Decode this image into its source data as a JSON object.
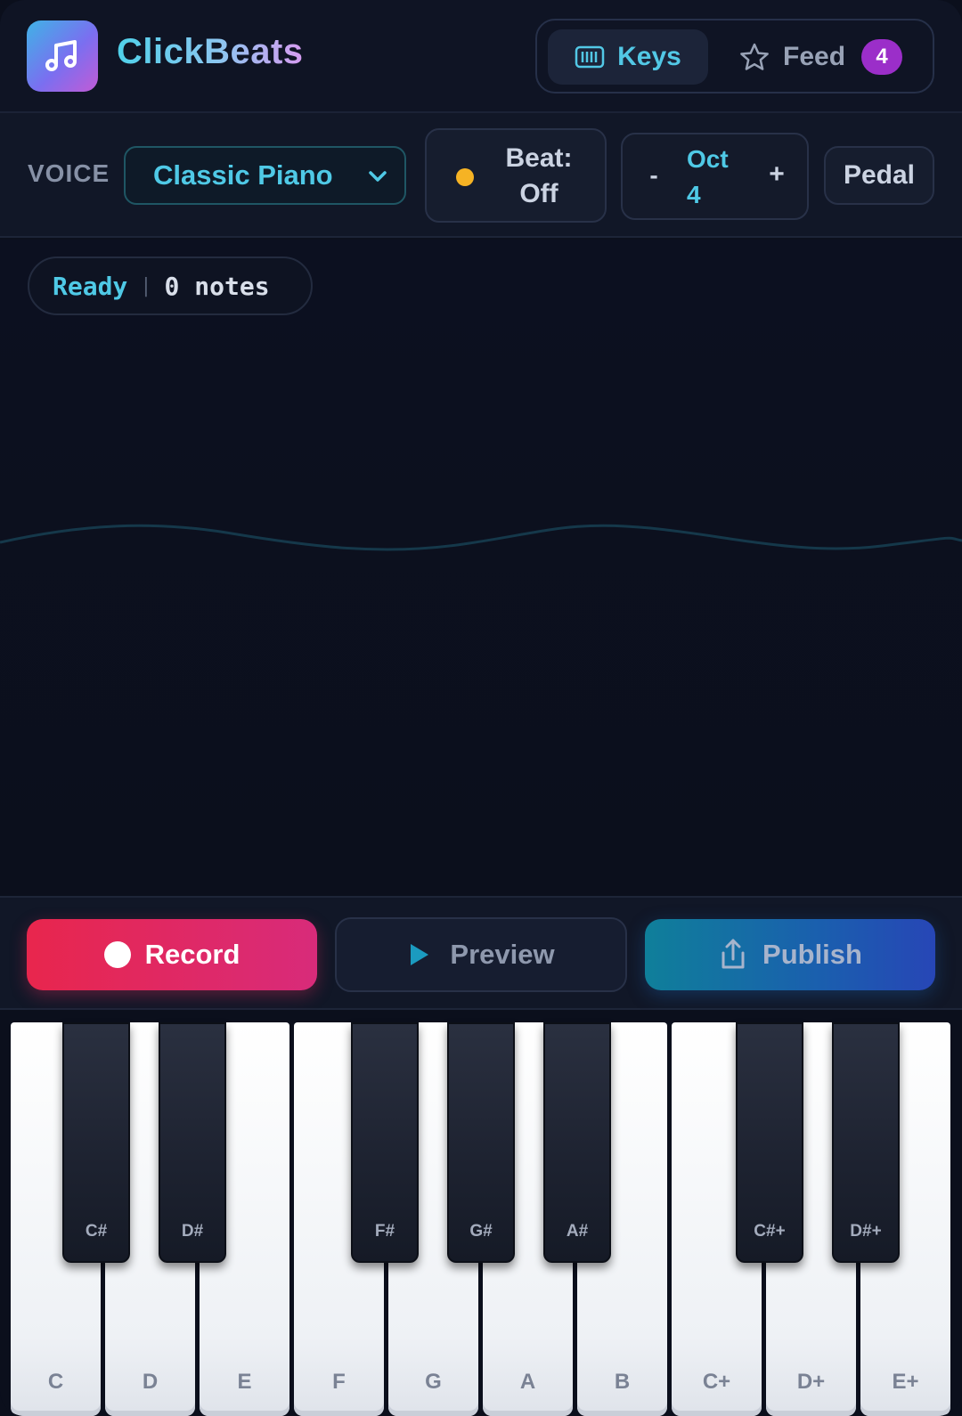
{
  "app": {
    "title": "ClickBeats"
  },
  "nav": {
    "keys_label": "Keys",
    "feed_label": "Feed",
    "feed_count": "4"
  },
  "controls": {
    "voice_label": "VOICE",
    "voice_value": "Classic Piano",
    "beat_line1": "Beat:",
    "beat_line2": "Off",
    "oct_minus": "-",
    "oct_line1": "Oct",
    "oct_line2": "4",
    "oct_plus": "+",
    "pedal_label": "Pedal"
  },
  "status": {
    "state": "Ready",
    "separator": "|",
    "count": "0 notes"
  },
  "actions": {
    "record_label": "Record",
    "preview_label": "Preview",
    "publish_label": "Publish"
  },
  "keyboard": {
    "white_keys": [
      "C",
      "D",
      "E",
      "F",
      "G",
      "A",
      "B",
      "C+",
      "D+",
      "E+"
    ],
    "black_keys": [
      "C#",
      "D#",
      "F#",
      "G#",
      "A#",
      "C#+",
      "D#+"
    ]
  },
  "colors": {
    "accent": "#4fc9e6",
    "record": "#e8264d",
    "badge": "#9b2ec9",
    "beat_dot": "#f6b324"
  }
}
